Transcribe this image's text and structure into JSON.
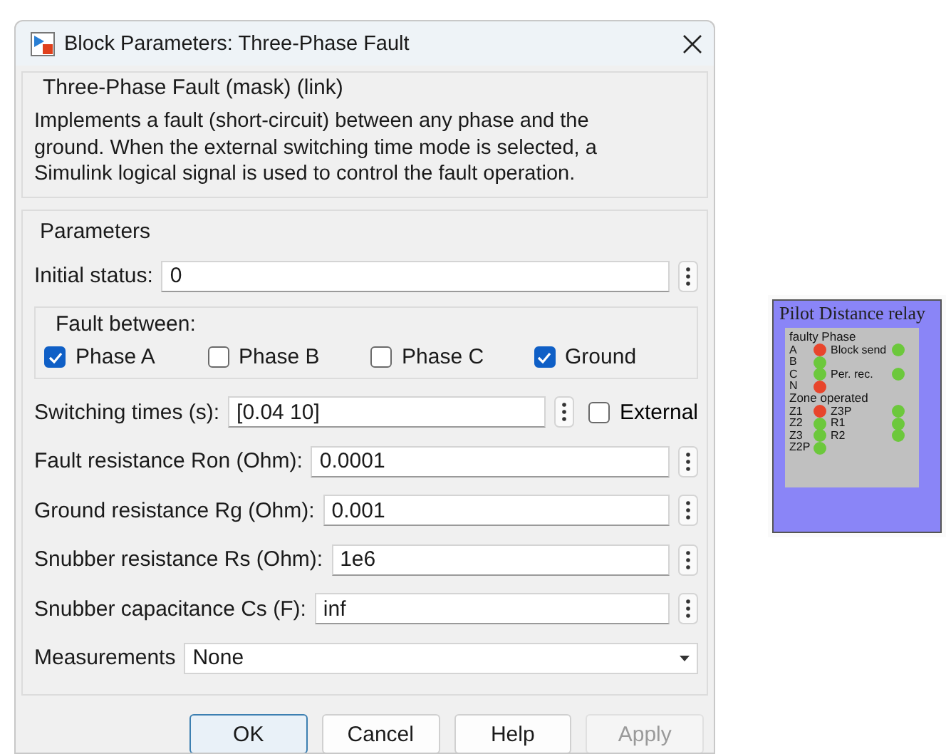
{
  "window": {
    "title": "Block Parameters: Three-Phase Fault"
  },
  "mask": {
    "heading": "Three-Phase Fault (mask) (link)",
    "description": "Implements a fault (short-circuit) between any phase and the ground. When the external switching time mode is selected, a Simulink logical signal is used to control the fault operation."
  },
  "parameters": {
    "heading": "Parameters",
    "items": [
      {
        "kind": "field",
        "label": "Initial status:",
        "value": "0"
      },
      {
        "kind": "checkgroup",
        "label": "Fault between:",
        "options": [
          {
            "label": "Phase A",
            "checked": true
          },
          {
            "label": "Phase B",
            "checked": false
          },
          {
            "label": "Phase C",
            "checked": false
          },
          {
            "label": "Ground",
            "checked": true
          }
        ]
      },
      {
        "kind": "field",
        "label": "Switching times (s):",
        "value": "[0.04 10]",
        "option": {
          "label": "External",
          "checked": false
        }
      },
      {
        "kind": "field",
        "label": "Fault resistance Ron (Ohm):",
        "value": "0.0001"
      },
      {
        "kind": "field",
        "label": "Ground resistance Rg (Ohm):",
        "value": "0.001"
      },
      {
        "kind": "field",
        "label": "Snubber resistance Rs (Ohm):",
        "value": "1e6"
      },
      {
        "kind": "field",
        "label": "Snubber capacitance Cs (F):",
        "value": "inf"
      },
      {
        "kind": "dropdown",
        "label": "Measurements",
        "value": "None"
      }
    ]
  },
  "buttons": [
    {
      "label": "OK",
      "disabled": false,
      "focused": true
    },
    {
      "label": "Cancel",
      "disabled": false,
      "focused": false
    },
    {
      "label": "Help",
      "disabled": false,
      "focused": false
    },
    {
      "label": "Apply",
      "disabled": true,
      "focused": false
    }
  ],
  "relay": {
    "title": "Pilot Distance relay",
    "sections": [
      {
        "heading": "faulty Phase",
        "rows": [
          [
            {
              "label": "A",
              "color": "#e8452c"
            },
            {
              "label": "Block send",
              "color": "#6cc83c"
            }
          ],
          [
            {
              "label": "B",
              "color": "#6cc83c"
            }
          ],
          [
            {
              "label": "C",
              "color": "#6cc83c"
            },
            {
              "label": "Per. rec.",
              "color": "#6cc83c"
            }
          ],
          [
            {
              "label": "N",
              "color": "#e8452c"
            }
          ]
        ]
      },
      {
        "heading": "Zone operated",
        "rows": [
          [
            {
              "label": "Z1",
              "color": "#e8452c"
            },
            {
              "label": "Z3P",
              "color": "#6cc83c"
            }
          ],
          [
            {
              "label": "Z2",
              "color": "#6cc83c"
            },
            {
              "label": "R1",
              "color": "#6cc83c"
            }
          ],
          [
            {
              "label": "Z3",
              "color": "#6cc83c"
            },
            {
              "label": "R2",
              "color": "#6cc83c"
            }
          ],
          [
            {
              "label": "Z2P",
              "color": "#6cc83c"
            }
          ]
        ]
      }
    ]
  }
}
